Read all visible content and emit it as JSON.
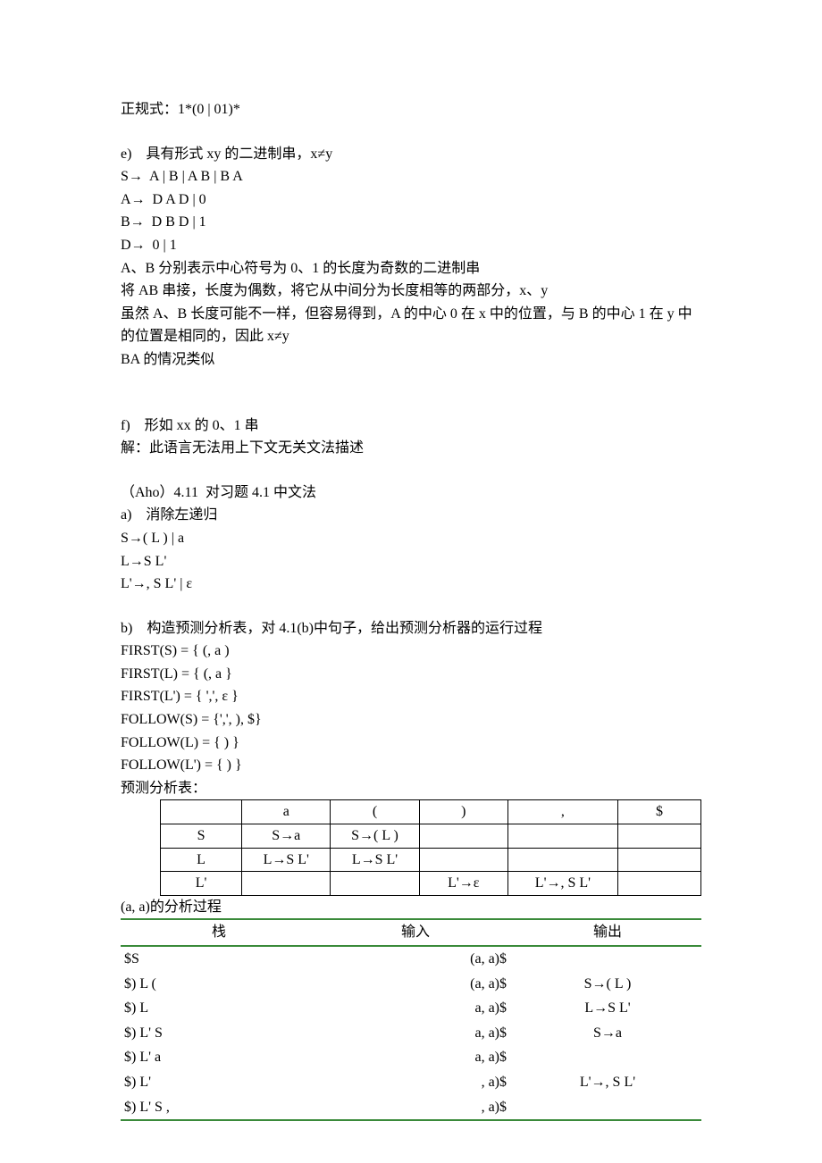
{
  "lines": {
    "regex": "正规式：1*(0 | 01)*",
    "e_head": "e)    具有形式 xy 的二进制串，x≠y",
    "e_p1": "S→  A | B | A B | B A",
    "e_p2": "A→  D A D | 0",
    "e_p3": "B→  D B D | 1",
    "e_p4": "D→  0 | 1",
    "e_note1": "A、B 分别表示中心符号为 0、1 的长度为奇数的二进制串",
    "e_note2": "将 AB 串接，长度为偶数，将它从中间分为长度相等的两部分，x、y",
    "e_note3": "虽然 A、B 长度可能不一样，但容易得到，A 的中心 0 在 x 中的位置，与 B 的中心 1 在 y 中的位置是相同的，因此 x≠y",
    "e_note4": "BA 的情况类似",
    "f_head": "f)    形如 xx 的 0、1 串",
    "f_ans": "解：此语言无法用上下文无关文法描述",
    "aho_head": "（Aho）4.11  对习题 4.1 中文法",
    "a_head": "a)    消除左递归",
    "a_p1": "S→( L ) | a",
    "a_p2": "L→S L'",
    "a_p3": "L'→, S L' | ε",
    "b_head": "b)    构造预测分析表，对 4.1(b)中句子，给出预测分析器的运行过程",
    "first_s": "FIRST(S) = { (, a )",
    "first_l": "FIRST(L) = { (, a }",
    "first_lp": "FIRST(L') = { ',', ε }",
    "follow_s": "FOLLOW(S) = {',', ), $}",
    "follow_l": "FOLLOW(L) = { ) }",
    "follow_lp": "FOLLOW(L') = { ) }",
    "parse_label": "预测分析表：",
    "trace_label": "(a, a)的分析过程"
  },
  "parse_table": {
    "headers": [
      "",
      "a",
      "(",
      ")",
      ",",
      "$"
    ],
    "rows": [
      [
        "S",
        "S→a",
        "S→( L )",
        "",
        "",
        ""
      ],
      [
        "L",
        "L→S L'",
        "L→S L'",
        "",
        "",
        ""
      ],
      [
        "L'",
        "",
        "",
        "L'→ε",
        "L'→, S L'",
        ""
      ]
    ]
  },
  "trace_table": {
    "headers": [
      "栈",
      "输入",
      "输出"
    ],
    "rows": [
      [
        "$S",
        "(a,  a)$",
        ""
      ],
      [
        "$) L (",
        "(a,  a)$",
        "S→( L )"
      ],
      [
        "$) L",
        "a,  a)$",
        "L→S L'"
      ],
      [
        "$) L' S",
        "a,  a)$",
        "S→a"
      ],
      [
        "$) L' a",
        "a,  a)$",
        ""
      ],
      [
        "$) L'",
        ",  a)$",
        "L'→, S L'"
      ],
      [
        "$) L' S ,",
        ",  a)$",
        ""
      ]
    ]
  }
}
